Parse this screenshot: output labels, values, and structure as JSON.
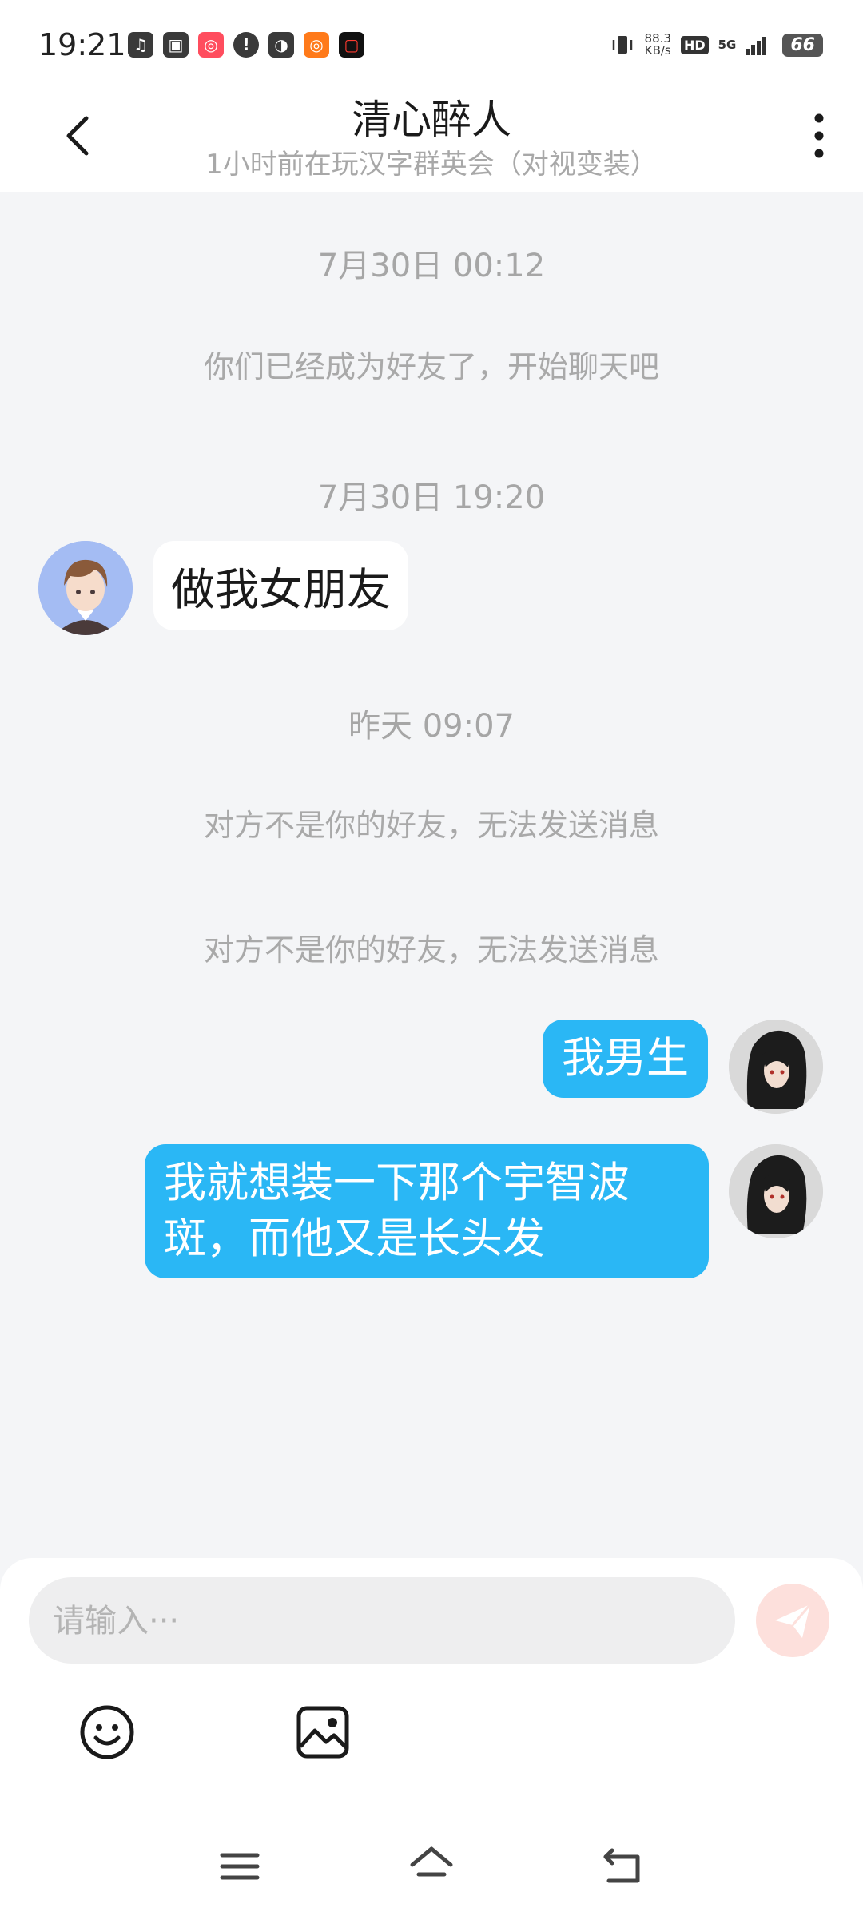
{
  "status_bar": {
    "time": "19:21",
    "net_speed_value": "88.3",
    "net_speed_unit": "KB/s",
    "hd_label": "HD",
    "network_label": "5G",
    "battery": "66",
    "app_icons": [
      "music-icon",
      "game-icon",
      "kuaishou-icon",
      "alert-icon",
      "wechat-icon",
      "kuaishou-icon",
      "video-icon"
    ]
  },
  "header": {
    "title": "清心醉人",
    "subtitle": "1小时前在玩汉字群英会（对视变装）"
  },
  "messages": {
    "ts1": "7月30日 00:12",
    "sys1": "你们已经成为好友了，开始聊天吧",
    "ts2": "7月30日 19:20",
    "in1": "做我女朋友",
    "ts3": "昨天 09:07",
    "sys2": "对方不是你的好友，无法发送消息",
    "sys3": "对方不是你的好友，无法发送消息",
    "out1": "我男生",
    "out2": "我就想装一下那个宇智波斑，而他又是长头发"
  },
  "composer": {
    "placeholder": "请输入···"
  },
  "colors": {
    "accent_bubble": "#2ab7f5",
    "chat_background": "#f4f5f7",
    "send_button": "#fde0dc"
  }
}
